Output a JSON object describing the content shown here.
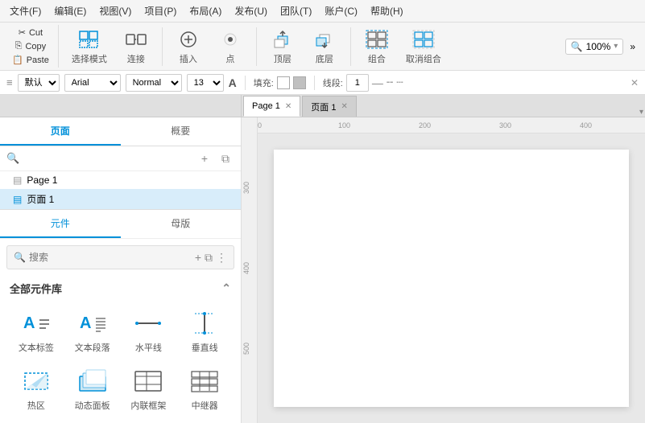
{
  "menubar": {
    "items": [
      "文件(F)",
      "编辑(E)",
      "视图(V)",
      "项目(P)",
      "布局(A)",
      "发布(U)",
      "团队(T)",
      "账户(C)",
      "帮助(H)"
    ]
  },
  "toolbar": {
    "cut": "Cut",
    "copy": "Copy",
    "paste": "Paste",
    "select_mode": "选择模式",
    "connect": "连接",
    "insert": "插入",
    "point": "点",
    "top_layer": "顶层",
    "bottom_layer": "底层",
    "group": "组合",
    "ungroup": "取消组合",
    "zoom": "100%",
    "more": "»"
  },
  "formatbar": {
    "style_label": "默认",
    "font": "Arial",
    "weight": "Normal",
    "size": "13",
    "fill_label": "填充:",
    "stroke_label": "线段:",
    "stroke_size": "1",
    "close": "✕"
  },
  "tabs": {
    "page1": "Page 1",
    "page2": "页面 1",
    "more": "▾"
  },
  "left_panel": {
    "pages_tab": "页面",
    "overview_tab": "概要",
    "pages": [
      {
        "name": "Page 1",
        "active": false
      },
      {
        "name": "页面 1",
        "active": true
      }
    ],
    "widgets_tab": "元件",
    "masters_tab": "母版",
    "search_placeholder": "搜索",
    "library_title": "全部元件库",
    "widgets": [
      {
        "label": "文本标签",
        "icon": "text-label"
      },
      {
        "label": "文本段落",
        "icon": "text-para"
      },
      {
        "label": "水平线",
        "icon": "h-line"
      },
      {
        "label": "垂直线",
        "icon": "v-line"
      },
      {
        "label": "热区",
        "icon": "hotspot"
      },
      {
        "label": "动态面板",
        "icon": "dynamic-panel"
      },
      {
        "label": "内联框架",
        "icon": "inline-frame"
      },
      {
        "label": "中继器",
        "icon": "repeater"
      }
    ]
  },
  "canvas": {
    "rulers": [
      "0",
      "100",
      "200",
      "300",
      "400"
    ],
    "ruler_v": [
      "300",
      "400",
      "500"
    ]
  }
}
